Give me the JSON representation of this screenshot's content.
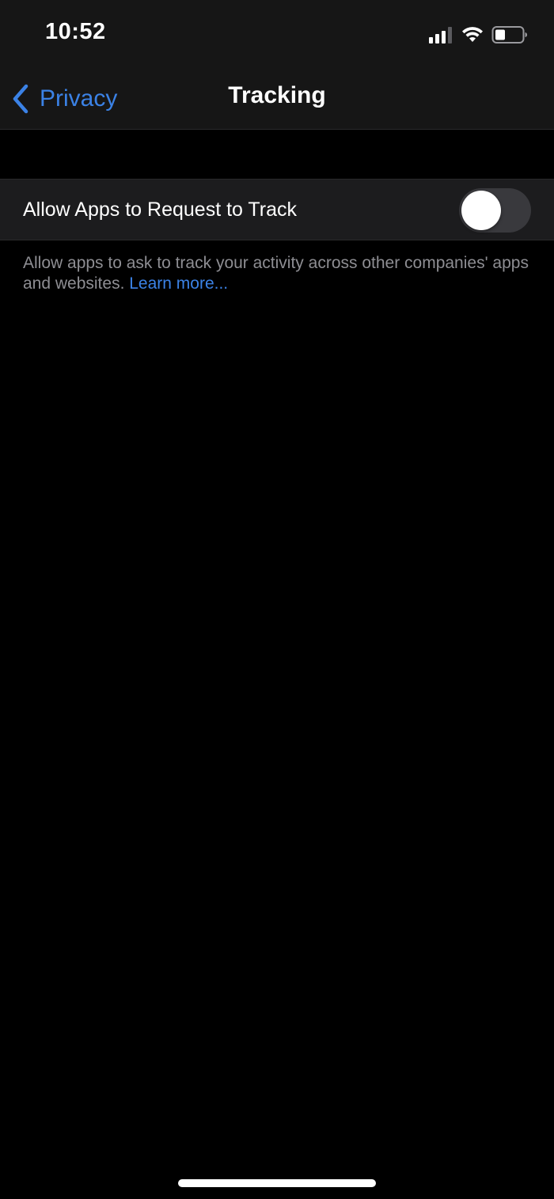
{
  "status_bar": {
    "time": "10:52",
    "icons": [
      "signal-icon",
      "wifi-icon",
      "battery-icon"
    ]
  },
  "nav": {
    "back_label": "Privacy",
    "back_icon": "chevron-left-icon",
    "title": "Tracking"
  },
  "setting": {
    "label": "Allow Apps to Request to Track",
    "toggle_on": false
  },
  "footer": {
    "text": "Allow apps to ask to track your activity across other companies' apps and websites. ",
    "link": "Learn more..."
  },
  "colors": {
    "accent": "#3b82e6",
    "background": "#000000",
    "nav_background": "#161616",
    "cell_background": "#1c1c1e",
    "secondary_text": "#8e8e93",
    "toggle_off": "#39393d"
  }
}
